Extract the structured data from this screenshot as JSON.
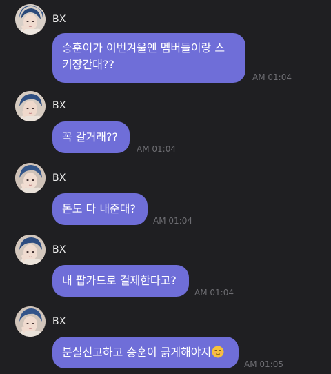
{
  "messages": [
    {
      "sender": "BX",
      "text": "승훈이가 이번겨울엔 멤버들이랑 스\n키장간대??",
      "time": "AM 01:04",
      "avatar_icon": "profile-photo"
    },
    {
      "sender": "BX",
      "text": "꼭 갈거래??",
      "time": "AM 01:04",
      "avatar_icon": "profile-photo"
    },
    {
      "sender": "BX",
      "text": "돈도 다 내준대?",
      "time": "AM 01:04",
      "avatar_icon": "profile-photo"
    },
    {
      "sender": "BX",
      "text": "내 팝카드로 결제한다고?",
      "time": "AM 01:04",
      "avatar_icon": "profile-photo"
    },
    {
      "sender": "BX",
      "text": "분실신고하고 승훈이 긁게해야지",
      "emoji": "smiling-face-emoji",
      "time": "AM 01:05",
      "avatar_icon": "profile-photo"
    }
  ],
  "colors": {
    "background": "#1f1f22",
    "bubble": "#6f6ed8",
    "bubble_text": "#ffffff",
    "name_text": "#ececec",
    "time_text": "#6d6d72"
  }
}
